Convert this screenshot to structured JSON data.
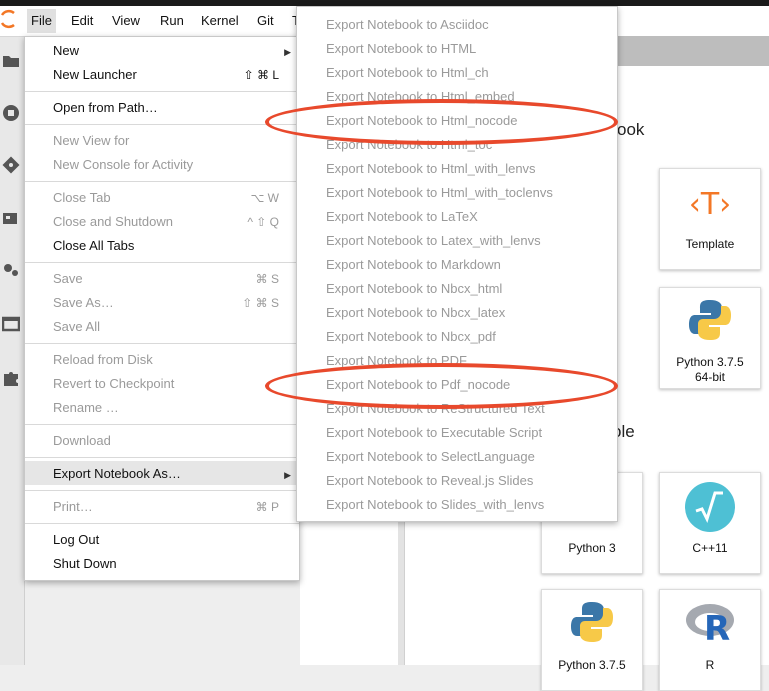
{
  "menubar": {
    "items": [
      "File",
      "Edit",
      "View",
      "Run",
      "Kernel",
      "Git",
      "T"
    ]
  },
  "file_menu": {
    "items": [
      {
        "label": "New",
        "shortcut": "",
        "submenu": true,
        "enabled": true
      },
      {
        "label": "New Launcher",
        "shortcut": "⇧ ⌘ L",
        "submenu": false,
        "enabled": true
      },
      {
        "label": "Open from Path…",
        "shortcut": "",
        "submenu": false,
        "enabled": true
      },
      {
        "label": "New View for",
        "shortcut": "",
        "submenu": false,
        "enabled": false
      },
      {
        "label": "New Console for Activity",
        "shortcut": "",
        "submenu": false,
        "enabled": false
      },
      {
        "label": "Close Tab",
        "shortcut": "⌥ W",
        "submenu": false,
        "enabled": false
      },
      {
        "label": "Close and Shutdown",
        "shortcut": "^ ⇧ Q",
        "submenu": false,
        "enabled": false
      },
      {
        "label": "Close All Tabs",
        "shortcut": "",
        "submenu": false,
        "enabled": true
      },
      {
        "label": "Save",
        "shortcut": "⌘ S",
        "submenu": false,
        "enabled": false
      },
      {
        "label": "Save As…",
        "shortcut": "⇧ ⌘ S",
        "submenu": false,
        "enabled": false
      },
      {
        "label": "Save All",
        "shortcut": "",
        "submenu": false,
        "enabled": false
      },
      {
        "label": "Reload from Disk",
        "shortcut": "",
        "submenu": false,
        "enabled": false
      },
      {
        "label": "Revert to Checkpoint",
        "shortcut": "",
        "submenu": false,
        "enabled": false
      },
      {
        "label": "Rename …",
        "shortcut": "",
        "submenu": false,
        "enabled": false
      },
      {
        "label": "Download",
        "shortcut": "",
        "submenu": false,
        "enabled": false
      },
      {
        "label": "Export Notebook As…",
        "shortcut": "",
        "submenu": true,
        "enabled": true
      },
      {
        "label": "Print…",
        "shortcut": "⌘ P",
        "submenu": false,
        "enabled": false
      },
      {
        "label": "Log Out",
        "shortcut": "",
        "submenu": false,
        "enabled": true
      },
      {
        "label": "Shut Down",
        "shortcut": "",
        "submenu": false,
        "enabled": true
      }
    ]
  },
  "export_submenu": {
    "items": [
      "Export Notebook to Asciidoc",
      "Export Notebook to HTML",
      "Export Notebook to Html_ch",
      "Export Notebook to Html_embed",
      "Export Notebook to Html_nocode",
      "Export Notebook to Html_toc",
      "Export Notebook to Html_with_lenvs",
      "Export Notebook to Html_with_toclenvs",
      "Export Notebook to LaTeX",
      "Export Notebook to Latex_with_lenvs",
      "Export Notebook to Markdown",
      "Export Notebook to Nbcx_html",
      "Export Notebook to Nbcx_latex",
      "Export Notebook to Nbcx_pdf",
      "Export Notebook to PDF",
      "Export Notebook to Pdf_nocode",
      "Export Notebook to ReStructured Text",
      "Export Notebook to Executable Script",
      "Export Notebook to SelectLanguage",
      "Export Notebook to Reveal.js Slides",
      "Export Notebook to Slides_with_lenvs"
    ]
  },
  "launcher": {
    "notebook_section": "ook",
    "console_section": "ole",
    "cards": {
      "template": "Template",
      "python375_a": "Python 3.7.5",
      "python375_b": "64-bit",
      "python3": "Python 3",
      "cpp": "C++11",
      "python375_c": "Python 3.7.5",
      "r": "R"
    },
    "template_glyph": "‹T›"
  },
  "colors": {
    "annotation": "#e8492c",
    "disabled_text": "#9a9a9a",
    "highlight": "#e6e6e6"
  }
}
